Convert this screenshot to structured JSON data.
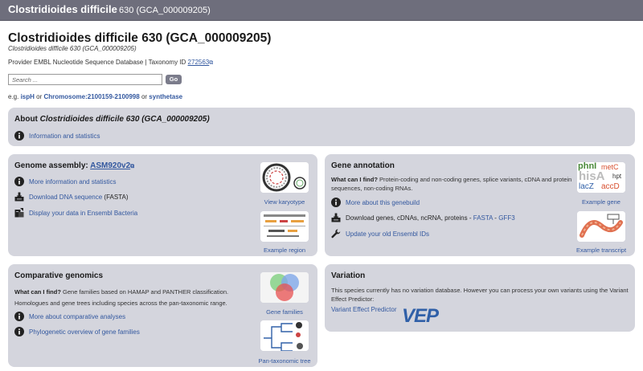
{
  "header": {
    "species": "Clostridioides difficile",
    "strain": "630 (GCA_000009205)"
  },
  "page": {
    "title": "Clostridioides difficile 630 (GCA_000009205)",
    "subtitle": "Clostridioides difficile 630 (GCA_000009205)",
    "provider_label": "Provider EMBL Nucleotide Sequence Database | Taxonomy ID",
    "taxonomy_id": "272563"
  },
  "search": {
    "placeholder": "Search ...",
    "go_label": "Go",
    "eg_prefix": "e.g.",
    "examples": [
      "ispH",
      "Chromosome:2100159-2100998",
      "synthetase"
    ],
    "or": "or"
  },
  "about": {
    "title_prefix": "About",
    "title_species": "Clostridioides difficile 630 (GCA_000009205)",
    "info_link": "Information and statistics"
  },
  "assembly": {
    "title_prefix": "Genome assembly:",
    "assembly_name": "ASM920v2",
    "more_info": "More information and statistics",
    "download_link": "Download DNA sequence",
    "download_suffix": "(FASTA)",
    "display_link": "Display your data in Ensembl Bacteria",
    "karyotype_label": "View karyotype",
    "region_label": "Example region"
  },
  "annotation": {
    "title": "Gene annotation",
    "what_label": "What can I find?",
    "what_text": "Protein-coding and non-coding genes, splice variants, cDNA and protein sequences, non-coding RNAs.",
    "genebuild_link": "More about this genebuild",
    "download_prefix": "Download genes, cDNAs, ncRNA, proteins -",
    "fasta": "FASTA",
    "dash": "-",
    "gff3": "GFF3",
    "update_link": "Update your old Ensembl IDs",
    "example_gene_label": "Example gene",
    "example_transcript_label": "Example transcript",
    "gene_words": [
      "phnI",
      "metC",
      "hisA",
      "hpt",
      "lacZ",
      "accD"
    ]
  },
  "comparative": {
    "title": "Comparative genomics",
    "what_label": "What can I find?",
    "what_text_1": "Gene families based on HAMAP and PANTHER classification.",
    "what_text_2": "Homologues and gene trees including species across the pan-taxonomic range.",
    "more_link": "More about comparative analyses",
    "overview_link": "Phylogenetic overview of gene families",
    "gene_families_label": "Gene families",
    "pan_tree_label": "Pan-taxonomic tree"
  },
  "variation": {
    "title": "Variation",
    "text": "This species currently has no variation database. However you can process your own variants using the Variant Effect Predictor:",
    "vep_link": "Variant Effect Predictor",
    "vep_logo": "VEP"
  },
  "colors": {
    "link": "#33589f",
    "panel": "#d4d5dd",
    "header": "#6e6e7c"
  }
}
